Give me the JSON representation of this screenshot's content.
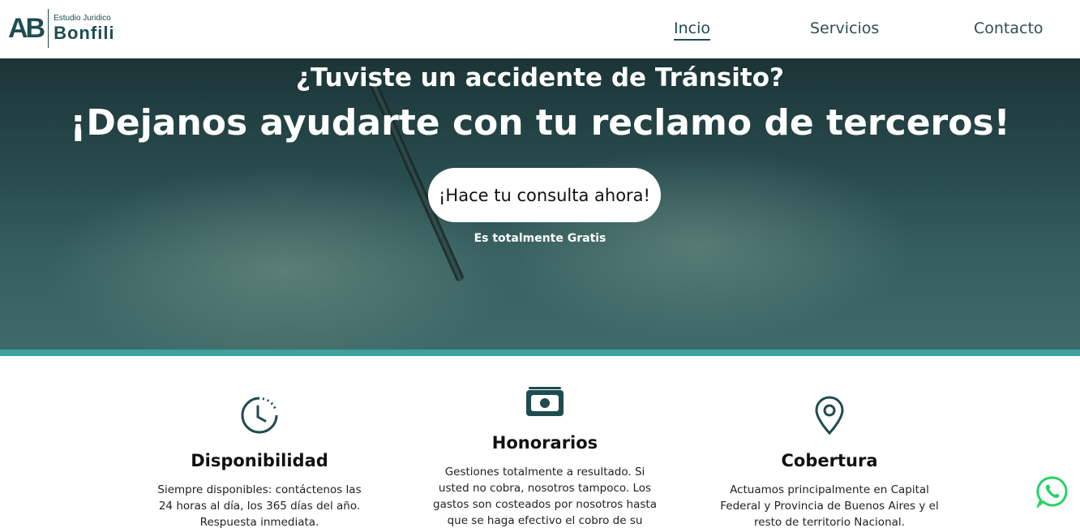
{
  "logo": {
    "mark": "AB",
    "subtitle": "Estudio Juridico",
    "name": "Bonfili"
  },
  "nav": {
    "items": [
      "Incio",
      "Servicios",
      "Contacto"
    ],
    "active": "Incio"
  },
  "hero": {
    "heading": "¿Tuviste un accidente de Tránsito?",
    "subheading": "¡Dejanos ayudarte con tu reclamo de terceros!",
    "cta_label": "¡Hace tu consulta ahora!",
    "cta_note": "Es totalmente Gratis"
  },
  "colors": {
    "brand": "#1f4c4f",
    "accent_stripe": "#3aa3a0",
    "whatsapp": "#25d366"
  },
  "features": [
    {
      "icon": "clock-icon",
      "title": "Disponibilidad",
      "desc": "Siempre disponibles: contáctenos las 24 horas al día, los 365 días del año. Respuesta inmediata."
    },
    {
      "icon": "money-icon",
      "title": "Honorarios",
      "desc": "Gestiones totalmente a resultado. Si usted no cobra, nosotros tampoco. Los gastos son costeados por nosotros hasta que se haga efectivo el cobro de su"
    },
    {
      "icon": "location-pin-icon",
      "title": "Cobertura",
      "desc": "Actuamos principalmente en Capital Federal y Provincia de Buenos Aires y el resto de territorio Nacional."
    }
  ],
  "whatsapp": {
    "icon": "whatsapp-icon"
  }
}
